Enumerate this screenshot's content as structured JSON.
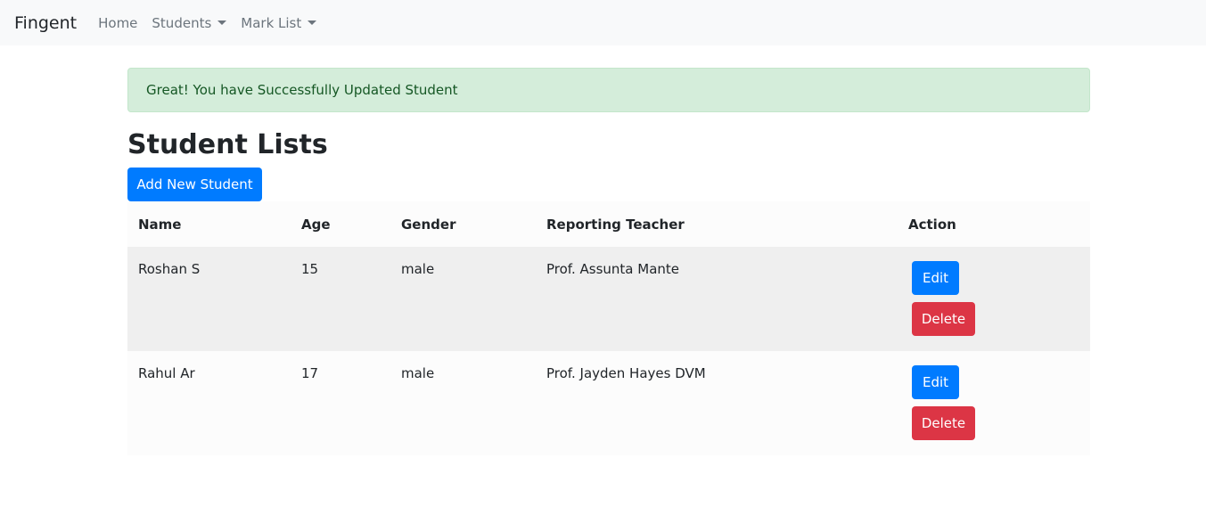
{
  "navbar": {
    "brand": "Fingent",
    "items": [
      {
        "label": "Home",
        "dropdown": false
      },
      {
        "label": "Students",
        "dropdown": true
      },
      {
        "label": "Mark List",
        "dropdown": true
      }
    ]
  },
  "alert": {
    "message": "Great! You have Successfully Updated Student"
  },
  "page": {
    "title": "Student Lists",
    "add_button_label": "Add New Student"
  },
  "table": {
    "headers": [
      "Name",
      "Age",
      "Gender",
      "Reporting Teacher",
      "Action"
    ],
    "rows": [
      {
        "name": "Roshan S",
        "age": "15",
        "gender": "male",
        "teacher": "Prof. Assunta Mante",
        "edit_label": "Edit",
        "delete_label": "Delete"
      },
      {
        "name": "Rahul Ar",
        "age": "17",
        "gender": "male",
        "teacher": "Prof. Jayden Hayes DVM",
        "edit_label": "Edit",
        "delete_label": "Delete"
      }
    ]
  },
  "colors": {
    "primary": "#007bff",
    "danger": "#dc3545",
    "alert_bg": "#d4edda",
    "alert_text": "#155724"
  }
}
